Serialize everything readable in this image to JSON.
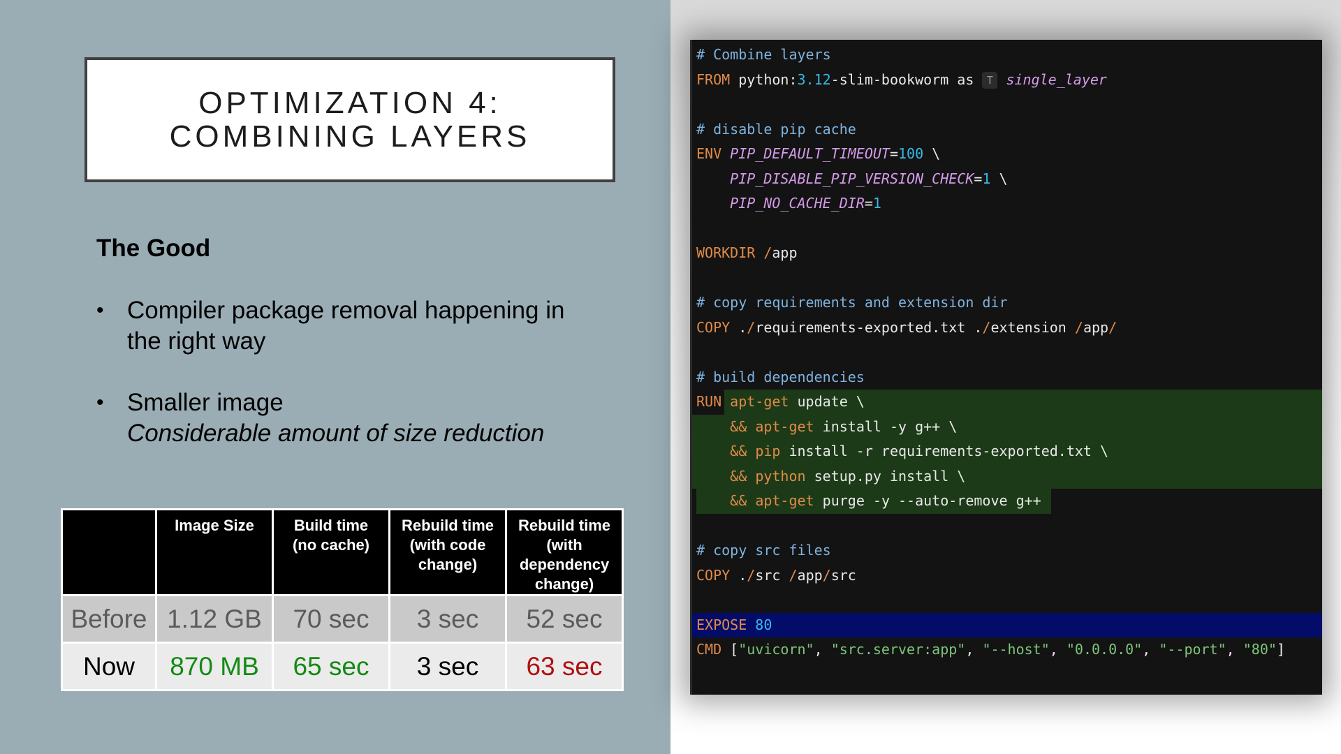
{
  "slide": {
    "title_line1": "OPTIMIZATION 4:",
    "title_line2": "COMBINING LAYERS",
    "section_heading": "The Good",
    "bullets": [
      {
        "line1": "Compiler package removal happening in",
        "line2": "the right way"
      },
      {
        "line1": "Smaller image",
        "line2": "Considerable amount of size reduction"
      }
    ],
    "bullet_glyph": "•"
  },
  "table": {
    "headers": [
      "",
      "Image Size",
      "Build time (no cache)",
      "Rebuild time (with code change)",
      "Rebuild time (with dependency change)"
    ],
    "header_lines": [
      [],
      [
        "Image Size"
      ],
      [
        "Build time",
        "(no cache)"
      ],
      [
        "Rebuild time",
        "(with code",
        "change)"
      ],
      [
        "Rebuild time",
        "(with",
        "dependency",
        "change)"
      ]
    ],
    "rows": [
      {
        "label": "Before",
        "cells": [
          "1.12 GB",
          "70 sec",
          "3 sec",
          "52 sec"
        ]
      },
      {
        "label": "Now",
        "cells": [
          "870 MB",
          "65 sec",
          "3 sec",
          "63 sec"
        ]
      }
    ],
    "now_colors": [
      "#000000",
      "#138a13",
      "#138a13",
      "#000000",
      "#b01010"
    ]
  },
  "code": {
    "lines": [
      {
        "tokens": [
          [
            "comment",
            "# Combine layers"
          ]
        ]
      },
      {
        "tokens": [
          [
            "kw",
            "FROM"
          ],
          [
            "plain",
            " python:"
          ],
          [
            "num",
            "3.12"
          ],
          [
            "plain",
            "-slim-bookworm as "
          ],
          [
            "icon",
            "T"
          ],
          [
            "plain",
            " "
          ],
          [
            "var",
            "single_layer"
          ]
        ]
      },
      {
        "tokens": []
      },
      {
        "tokens": [
          [
            "comment",
            "# disable pip cache"
          ]
        ]
      },
      {
        "tokens": [
          [
            "kw",
            "ENV"
          ],
          [
            "plain",
            " "
          ],
          [
            "var",
            "PIP_DEFAULT_TIMEOUT"
          ],
          [
            "plain",
            "="
          ],
          [
            "num",
            "100"
          ],
          [
            "plain",
            " \\"
          ]
        ]
      },
      {
        "tokens": [
          [
            "plain",
            "    "
          ],
          [
            "var",
            "PIP_DISABLE_PIP_VERSION_CHECK"
          ],
          [
            "plain",
            "="
          ],
          [
            "num",
            "1"
          ],
          [
            "plain",
            " \\"
          ]
        ]
      },
      {
        "tokens": [
          [
            "plain",
            "    "
          ],
          [
            "var",
            "PIP_NO_CACHE_DIR"
          ],
          [
            "plain",
            "="
          ],
          [
            "num",
            "1"
          ]
        ]
      },
      {
        "tokens": []
      },
      {
        "tokens": [
          [
            "kw",
            "WORKDIR"
          ],
          [
            "plain",
            " "
          ],
          [
            "kw",
            "/"
          ],
          [
            "plain",
            "app"
          ]
        ]
      },
      {
        "tokens": []
      },
      {
        "tokens": [
          [
            "comment",
            "# copy requirements and extension dir"
          ]
        ]
      },
      {
        "tokens": [
          [
            "kw",
            "COPY"
          ],
          [
            "plain",
            " ."
          ],
          [
            "kw",
            "/"
          ],
          [
            "plain",
            "requirements-exported.txt ."
          ],
          [
            "kw",
            "/"
          ],
          [
            "plain",
            "extension "
          ],
          [
            "kw",
            "/"
          ],
          [
            "plain",
            "app"
          ],
          [
            "kw",
            "/"
          ]
        ]
      },
      {
        "tokens": []
      },
      {
        "tokens": [
          [
            "comment",
            "# build dependencies"
          ]
        ]
      },
      {
        "hl": "green",
        "hl_from": 1,
        "tokens": [
          [
            "kw",
            "RUN"
          ],
          [
            "plain",
            " "
          ],
          [
            "kw",
            "apt-get"
          ],
          [
            "plain",
            " update \\"
          ]
        ]
      },
      {
        "hl": "green",
        "tokens": [
          [
            "plain",
            "    "
          ],
          [
            "kw",
            "&&"
          ],
          [
            "plain",
            " "
          ],
          [
            "kw",
            "apt-get"
          ],
          [
            "plain",
            " install -y g++ \\"
          ]
        ]
      },
      {
        "hl": "green",
        "tokens": [
          [
            "plain",
            "    "
          ],
          [
            "kw",
            "&&"
          ],
          [
            "plain",
            " "
          ],
          [
            "kw",
            "pip"
          ],
          [
            "plain",
            " install -r requirements-exported.txt \\"
          ]
        ]
      },
      {
        "hl": "green",
        "tokens": [
          [
            "plain",
            "    "
          ],
          [
            "kw",
            "&&"
          ],
          [
            "plain",
            " "
          ],
          [
            "kw",
            "python"
          ],
          [
            "plain",
            " setup.py install \\"
          ]
        ]
      },
      {
        "hl": "green-short",
        "tokens": [
          [
            "plain",
            "    "
          ],
          [
            "kw",
            "&&"
          ],
          [
            "plain",
            " "
          ],
          [
            "kw",
            "apt-get"
          ],
          [
            "plain",
            " purge -y --auto-remove g++"
          ]
        ]
      },
      {
        "tokens": []
      },
      {
        "tokens": [
          [
            "comment",
            "# copy src files"
          ]
        ]
      },
      {
        "tokens": [
          [
            "kw",
            "COPY"
          ],
          [
            "plain",
            " ."
          ],
          [
            "kw",
            "/"
          ],
          [
            "plain",
            "src "
          ],
          [
            "kw",
            "/"
          ],
          [
            "plain",
            "app"
          ],
          [
            "kw",
            "/"
          ],
          [
            "plain",
            "src"
          ]
        ]
      },
      {
        "tokens": []
      },
      {
        "hl": "blue",
        "tokens": [
          [
            "kw",
            "EXPOSE"
          ],
          [
            "plain",
            " "
          ],
          [
            "num",
            "80"
          ]
        ]
      },
      {
        "tokens": [
          [
            "kw",
            "CMD"
          ],
          [
            "plain",
            " ["
          ],
          [
            "str",
            "\"uvicorn\""
          ],
          [
            "plain",
            ", "
          ],
          [
            "str",
            "\"src.server:app\""
          ],
          [
            "plain",
            ", "
          ],
          [
            "str",
            "\"--host\""
          ],
          [
            "plain",
            ", "
          ],
          [
            "str",
            "\"0.0.0.0\""
          ],
          [
            "plain",
            ", "
          ],
          [
            "str",
            "\"--port\""
          ],
          [
            "plain",
            ", "
          ],
          [
            "str",
            "\"80\""
          ],
          [
            "plain",
            "]"
          ]
        ]
      }
    ],
    "colors": {
      "comment": "#7fb3df",
      "keyword": "#e08a4a",
      "number": "#39b8e6",
      "variable": "#d39be8",
      "string": "#7dc57a",
      "highlight_green": "#1c3a17",
      "highlight_blue": "#040c6a",
      "background": "#131313"
    }
  }
}
